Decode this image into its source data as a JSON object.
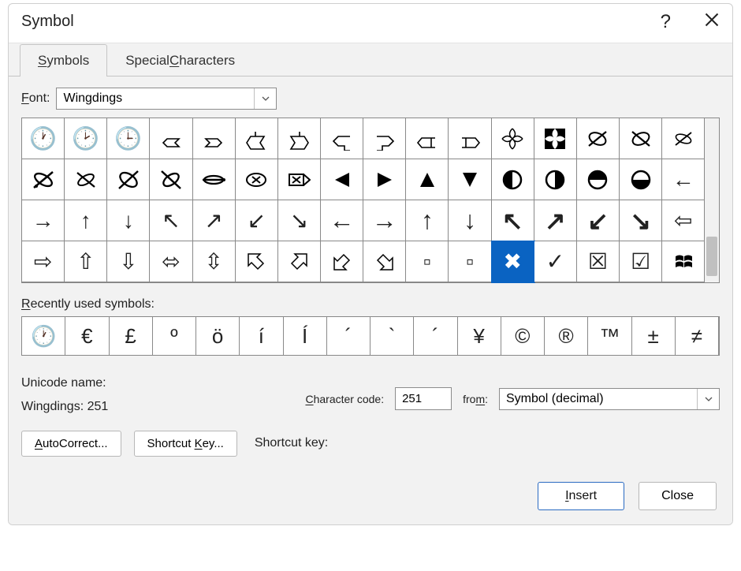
{
  "window": {
    "title": "Symbol"
  },
  "tabs": {
    "symbols": "Symbols",
    "special": "Special Characters"
  },
  "font_row": {
    "label": "Font:",
    "value": "Wingdings"
  },
  "symbol_grid": {
    "selected_index": 59,
    "cells": [
      {
        "g": "🕐"
      },
      {
        "g": "🕑"
      },
      {
        "g": "🕒"
      },
      {
        "svg": "ribbon-left"
      },
      {
        "svg": "ribbon-right"
      },
      {
        "svg": "ribbon-m-left"
      },
      {
        "svg": "ribbon-m-right"
      },
      {
        "svg": "ribbon-z-left"
      },
      {
        "svg": "ribbon-z-right"
      },
      {
        "svg": "ribbon-h-left"
      },
      {
        "svg": "ribbon-h-right"
      },
      {
        "g": "✕",
        "svg": "cross-leaves"
      },
      {
        "svg": "leaves-solid"
      },
      {
        "svg": "leaf-slash"
      },
      {
        "svg": "leaf-slash-r"
      },
      {
        "svg": "leaf-slash-thin"
      },
      {
        "svg": "leaf-s-1"
      },
      {
        "svg": "leaf-s-2"
      },
      {
        "svg": "leaf-s-3"
      },
      {
        "svg": "leaf-s-4"
      },
      {
        "svg": "leaf-s-5"
      },
      {
        "svg": "boxed-x"
      },
      {
        "svg": "boxed-x-arrow"
      },
      {
        "g": "◀",
        "svg": "tri-left"
      },
      {
        "g": "▶",
        "svg": "tri-right"
      },
      {
        "g": "▲",
        "svg": "tri-up"
      },
      {
        "g": "▼",
        "svg": "tri-down"
      },
      {
        "svg": "half-circle-l"
      },
      {
        "svg": "half-circle-r"
      },
      {
        "svg": "half-circle-up"
      },
      {
        "svg": "half-circle-dn"
      },
      {
        "g": "←"
      },
      {
        "g": "→"
      },
      {
        "g": "↑"
      },
      {
        "g": "↓"
      },
      {
        "g": "↖"
      },
      {
        "g": "↗"
      },
      {
        "g": "↙"
      },
      {
        "g": "↘"
      },
      {
        "g": "←",
        "bold": true
      },
      {
        "g": "→",
        "bold": true
      },
      {
        "g": "↑",
        "bold": true
      },
      {
        "g": "↓",
        "bold": true
      },
      {
        "g": "↖",
        "bold": true
      },
      {
        "g": "↗",
        "bold": true
      },
      {
        "g": "↙",
        "bold": true
      },
      {
        "g": "↘",
        "bold": true
      },
      {
        "g": "⇦"
      },
      {
        "g": "⇨"
      },
      {
        "g": "⇧"
      },
      {
        "g": "⇩"
      },
      {
        "g": "⬄"
      },
      {
        "g": "⇳"
      },
      {
        "svg": "arrow-3d-nw"
      },
      {
        "svg": "arrow-3d-ne"
      },
      {
        "svg": "arrow-3d-sw"
      },
      {
        "svg": "arrow-3d-se"
      },
      {
        "g": "▫"
      },
      {
        "g": "▫"
      },
      {
        "g": "✖",
        "selected": true
      },
      {
        "g": "✓"
      },
      {
        "g": "☒"
      },
      {
        "g": "☑"
      },
      {
        "svg": "windows-logo"
      }
    ]
  },
  "recent": {
    "label": "Recently used symbols:",
    "cells": [
      {
        "g": "🕐"
      },
      {
        "g": "€"
      },
      {
        "g": "£"
      },
      {
        "g": "º"
      },
      {
        "g": "ö"
      },
      {
        "g": "í"
      },
      {
        "g": "Í"
      },
      {
        "g": "´"
      },
      {
        "g": "`"
      },
      {
        "g": "´"
      },
      {
        "g": "¥"
      },
      {
        "g": "©"
      },
      {
        "g": "®"
      },
      {
        "g": "™"
      },
      {
        "g": "±"
      },
      {
        "g": "≠"
      }
    ]
  },
  "unicode": {
    "name_label": "Unicode name:",
    "name_value": "Wingdings: 251",
    "cc_label": "Character code:",
    "cc_value": "251",
    "from_label": "from:",
    "from_value": "Symbol (decimal)"
  },
  "buttons": {
    "autocorrect": "AutoCorrect...",
    "shortcut_key_btn": "Shortcut Key...",
    "shortcut_key_label": "Shortcut key:",
    "insert": "Insert",
    "close": "Close"
  }
}
